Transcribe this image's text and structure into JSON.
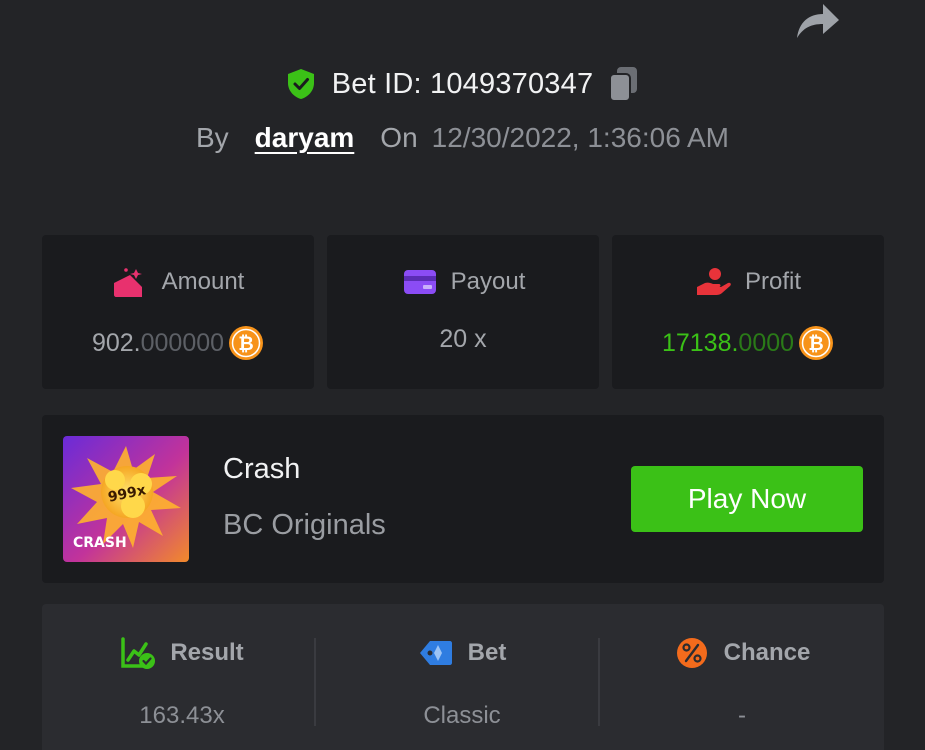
{
  "header": {
    "bet_id_label": "Bet ID: 1049370347",
    "by_label": "By",
    "username": "daryam",
    "on_label": "On",
    "datetime": "12/30/2022, 1:36:06 AM"
  },
  "stats": {
    "amount": {
      "label": "Amount",
      "value_main": "902.",
      "value_faded": "000000",
      "currency_icon": "bitcoin-coin-icon"
    },
    "payout": {
      "label": "Payout",
      "value": "20 x"
    },
    "profit": {
      "label": "Profit",
      "value_main": "17138.",
      "value_faded": "0000",
      "currency_icon": "bitcoin-coin-icon"
    }
  },
  "game": {
    "name": "Crash",
    "provider": "BC Originals",
    "play_label": "Play Now",
    "thumb_badge": "999x",
    "thumb_title": "CRASH"
  },
  "result": {
    "result_label": "Result",
    "result_value": "163.43x",
    "bet_label": "Bet",
    "bet_value": "Classic",
    "chance_label": "Chance",
    "chance_value": "-"
  },
  "colors": {
    "background": "#232427",
    "card": "#1a1b1e",
    "accent_green": "#3bc117",
    "profit_green": "#3bc117",
    "bitcoin_orange": "#f7931a"
  }
}
